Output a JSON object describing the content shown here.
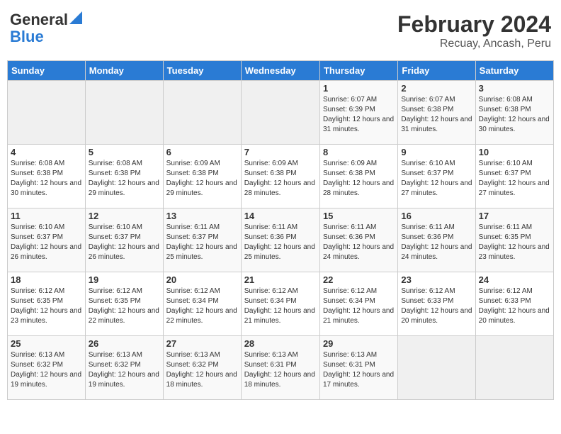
{
  "header": {
    "logo_line1": "General",
    "logo_line2": "Blue",
    "title": "February 2024",
    "subtitle": "Recuay, Ancash, Peru"
  },
  "days_of_week": [
    "Sunday",
    "Monday",
    "Tuesday",
    "Wednesday",
    "Thursday",
    "Friday",
    "Saturday"
  ],
  "weeks": [
    [
      {
        "day": "",
        "info": ""
      },
      {
        "day": "",
        "info": ""
      },
      {
        "day": "",
        "info": ""
      },
      {
        "day": "",
        "info": ""
      },
      {
        "day": "1",
        "info": "Sunrise: 6:07 AM\nSunset: 6:39 PM\nDaylight: 12 hours\nand 31 minutes."
      },
      {
        "day": "2",
        "info": "Sunrise: 6:07 AM\nSunset: 6:38 PM\nDaylight: 12 hours\nand 31 minutes."
      },
      {
        "day": "3",
        "info": "Sunrise: 6:08 AM\nSunset: 6:38 PM\nDaylight: 12 hours\nand 30 minutes."
      }
    ],
    [
      {
        "day": "4",
        "info": "Sunrise: 6:08 AM\nSunset: 6:38 PM\nDaylight: 12 hours\nand 30 minutes."
      },
      {
        "day": "5",
        "info": "Sunrise: 6:08 AM\nSunset: 6:38 PM\nDaylight: 12 hours\nand 29 minutes."
      },
      {
        "day": "6",
        "info": "Sunrise: 6:09 AM\nSunset: 6:38 PM\nDaylight: 12 hours\nand 29 minutes."
      },
      {
        "day": "7",
        "info": "Sunrise: 6:09 AM\nSunset: 6:38 PM\nDaylight: 12 hours\nand 28 minutes."
      },
      {
        "day": "8",
        "info": "Sunrise: 6:09 AM\nSunset: 6:38 PM\nDaylight: 12 hours\nand 28 minutes."
      },
      {
        "day": "9",
        "info": "Sunrise: 6:10 AM\nSunset: 6:37 PM\nDaylight: 12 hours\nand 27 minutes."
      },
      {
        "day": "10",
        "info": "Sunrise: 6:10 AM\nSunset: 6:37 PM\nDaylight: 12 hours\nand 27 minutes."
      }
    ],
    [
      {
        "day": "11",
        "info": "Sunrise: 6:10 AM\nSunset: 6:37 PM\nDaylight: 12 hours\nand 26 minutes."
      },
      {
        "day": "12",
        "info": "Sunrise: 6:10 AM\nSunset: 6:37 PM\nDaylight: 12 hours\nand 26 minutes."
      },
      {
        "day": "13",
        "info": "Sunrise: 6:11 AM\nSunset: 6:37 PM\nDaylight: 12 hours\nand 25 minutes."
      },
      {
        "day": "14",
        "info": "Sunrise: 6:11 AM\nSunset: 6:36 PM\nDaylight: 12 hours\nand 25 minutes."
      },
      {
        "day": "15",
        "info": "Sunrise: 6:11 AM\nSunset: 6:36 PM\nDaylight: 12 hours\nand 24 minutes."
      },
      {
        "day": "16",
        "info": "Sunrise: 6:11 AM\nSunset: 6:36 PM\nDaylight: 12 hours\nand 24 minutes."
      },
      {
        "day": "17",
        "info": "Sunrise: 6:11 AM\nSunset: 6:35 PM\nDaylight: 12 hours\nand 23 minutes."
      }
    ],
    [
      {
        "day": "18",
        "info": "Sunrise: 6:12 AM\nSunset: 6:35 PM\nDaylight: 12 hours\nand 23 minutes."
      },
      {
        "day": "19",
        "info": "Sunrise: 6:12 AM\nSunset: 6:35 PM\nDaylight: 12 hours\nand 22 minutes."
      },
      {
        "day": "20",
        "info": "Sunrise: 6:12 AM\nSunset: 6:34 PM\nDaylight: 12 hours\nand 22 minutes."
      },
      {
        "day": "21",
        "info": "Sunrise: 6:12 AM\nSunset: 6:34 PM\nDaylight: 12 hours\nand 21 minutes."
      },
      {
        "day": "22",
        "info": "Sunrise: 6:12 AM\nSunset: 6:34 PM\nDaylight: 12 hours\nand 21 minutes."
      },
      {
        "day": "23",
        "info": "Sunrise: 6:12 AM\nSunset: 6:33 PM\nDaylight: 12 hours\nand 20 minutes."
      },
      {
        "day": "24",
        "info": "Sunrise: 6:12 AM\nSunset: 6:33 PM\nDaylight: 12 hours\nand 20 minutes."
      }
    ],
    [
      {
        "day": "25",
        "info": "Sunrise: 6:13 AM\nSunset: 6:32 PM\nDaylight: 12 hours\nand 19 minutes."
      },
      {
        "day": "26",
        "info": "Sunrise: 6:13 AM\nSunset: 6:32 PM\nDaylight: 12 hours\nand 19 minutes."
      },
      {
        "day": "27",
        "info": "Sunrise: 6:13 AM\nSunset: 6:32 PM\nDaylight: 12 hours\nand 18 minutes."
      },
      {
        "day": "28",
        "info": "Sunrise: 6:13 AM\nSunset: 6:31 PM\nDaylight: 12 hours\nand 18 minutes."
      },
      {
        "day": "29",
        "info": "Sunrise: 6:13 AM\nSunset: 6:31 PM\nDaylight: 12 hours\nand 17 minutes."
      },
      {
        "day": "",
        "info": ""
      },
      {
        "day": "",
        "info": ""
      }
    ]
  ]
}
